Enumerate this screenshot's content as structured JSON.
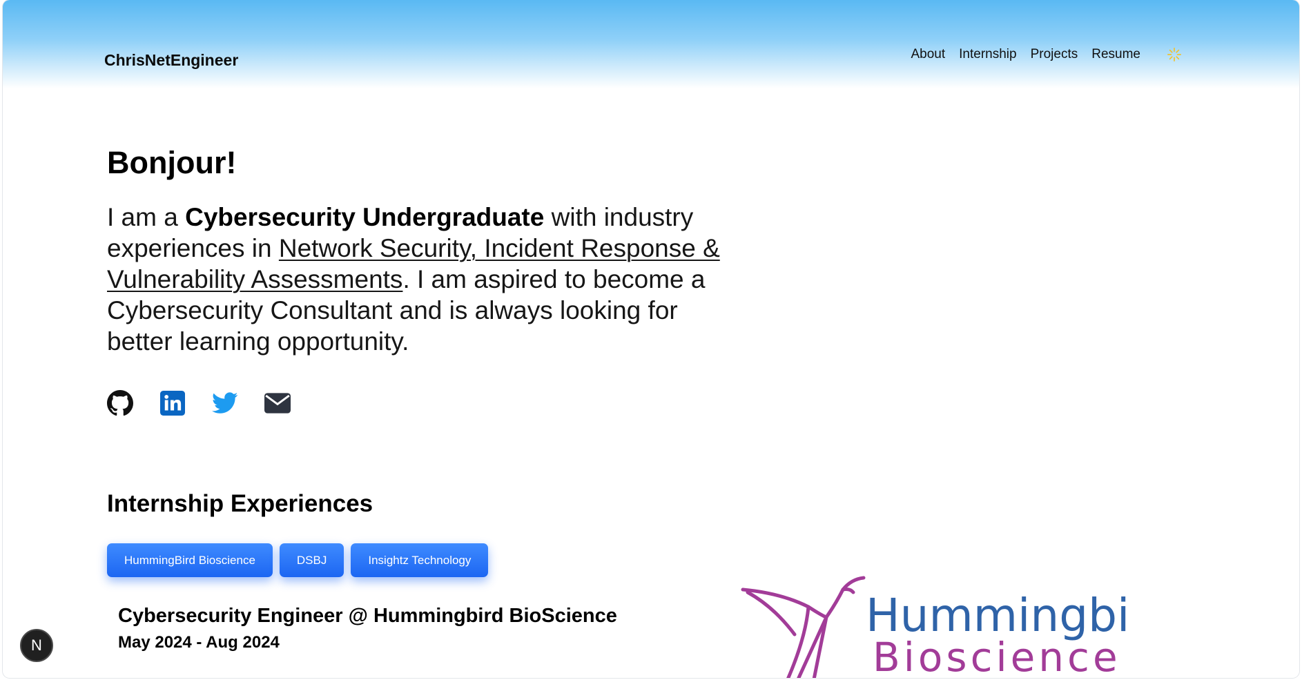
{
  "brand": "ChrisNetEngineer",
  "nav": {
    "about": "About",
    "internship": "Internship",
    "projects": "Projects",
    "resume": "Resume",
    "theme_icon": "sun-icon"
  },
  "hero": {
    "title": "Bonjour!",
    "intro_pre": "I am a ",
    "intro_bold": "Cybersecurity Undergraduate",
    "intro_mid": " with industry experiences in ",
    "intro_link": "Network Security, Incident Response & Vulnerability Assessments",
    "intro_post": ". I am aspired to become a Cybersecurity Consultant and is always looking for better learning opportunity."
  },
  "socials": [
    "github-icon",
    "linkedin-icon",
    "twitter-icon",
    "email-icon"
  ],
  "internship": {
    "title": "Internship Experiences",
    "tabs": [
      "HummingBird Bioscience",
      "DSBJ",
      "Insightz Technology"
    ],
    "role": "Cybersecurity Engineer @ Hummingbird BioScience",
    "dates": "May 2024 - Aug 2024",
    "logo": {
      "line1": "Hummingbird",
      "line2": "Bioscience"
    }
  },
  "badge": "N",
  "colors": {
    "accent_blue": "#1f6af5",
    "linkedin": "#0a66c2",
    "twitter": "#1d9bf0",
    "logo_blue": "#2f63a8",
    "logo_magenta": "#a23c98",
    "sun": "#f2c22a"
  }
}
